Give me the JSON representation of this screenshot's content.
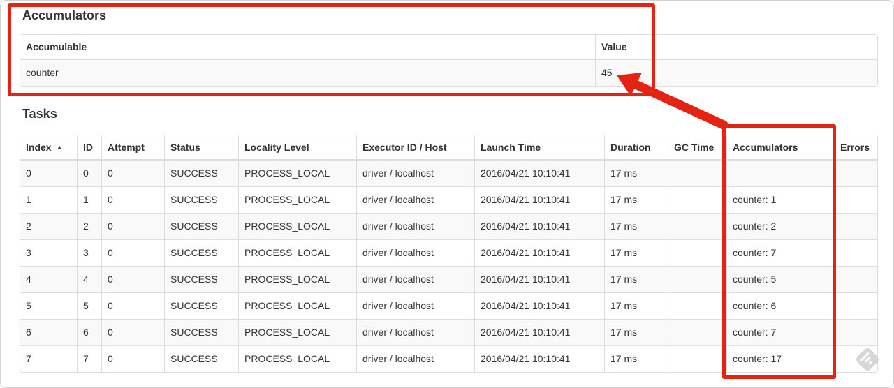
{
  "accumulators_section": {
    "title": "Accumulators",
    "table": {
      "headers": [
        "Accumulable",
        "Value"
      ],
      "rows": [
        {
          "accumulable": "counter",
          "value": "45"
        }
      ]
    }
  },
  "tasks_section": {
    "title": "Tasks",
    "table": {
      "headers": [
        "Index",
        "ID",
        "Attempt",
        "Status",
        "Locality Level",
        "Executor ID / Host",
        "Launch Time",
        "Duration",
        "GC Time",
        "Accumulators",
        "Errors"
      ],
      "sort": {
        "column": "Index",
        "direction": "ascending",
        "icon": "▲"
      },
      "rows": [
        {
          "index": "0",
          "id": "0",
          "attempt": "0",
          "status": "SUCCESS",
          "locality_level": "PROCESS_LOCAL",
          "executor_id_host": "driver / localhost",
          "launch_time": "2016/04/21 10:10:41",
          "duration": "17 ms",
          "gc_time": "",
          "accumulators": "",
          "errors": ""
        },
        {
          "index": "1",
          "id": "1",
          "attempt": "0",
          "status": "SUCCESS",
          "locality_level": "PROCESS_LOCAL",
          "executor_id_host": "driver / localhost",
          "launch_time": "2016/04/21 10:10:41",
          "duration": "17 ms",
          "gc_time": "",
          "accumulators": "counter: 1",
          "errors": ""
        },
        {
          "index": "2",
          "id": "2",
          "attempt": "0",
          "status": "SUCCESS",
          "locality_level": "PROCESS_LOCAL",
          "executor_id_host": "driver / localhost",
          "launch_time": "2016/04/21 10:10:41",
          "duration": "17 ms",
          "gc_time": "",
          "accumulators": "counter: 2",
          "errors": ""
        },
        {
          "index": "3",
          "id": "3",
          "attempt": "0",
          "status": "SUCCESS",
          "locality_level": "PROCESS_LOCAL",
          "executor_id_host": "driver / localhost",
          "launch_time": "2016/04/21 10:10:41",
          "duration": "17 ms",
          "gc_time": "",
          "accumulators": "counter: 7",
          "errors": ""
        },
        {
          "index": "4",
          "id": "4",
          "attempt": "0",
          "status": "SUCCESS",
          "locality_level": "PROCESS_LOCAL",
          "executor_id_host": "driver / localhost",
          "launch_time": "2016/04/21 10:10:41",
          "duration": "17 ms",
          "gc_time": "",
          "accumulators": "counter: 5",
          "errors": ""
        },
        {
          "index": "5",
          "id": "5",
          "attempt": "0",
          "status": "SUCCESS",
          "locality_level": "PROCESS_LOCAL",
          "executor_id_host": "driver / localhost",
          "launch_time": "2016/04/21 10:10:41",
          "duration": "17 ms",
          "gc_time": "",
          "accumulators": "counter: 6",
          "errors": ""
        },
        {
          "index": "6",
          "id": "6",
          "attempt": "0",
          "status": "SUCCESS",
          "locality_level": "PROCESS_LOCAL",
          "executor_id_host": "driver / localhost",
          "launch_time": "2016/04/21 10:10:41",
          "duration": "17 ms",
          "gc_time": "",
          "accumulators": "counter: 7",
          "errors": ""
        },
        {
          "index": "7",
          "id": "7",
          "attempt": "0",
          "status": "SUCCESS",
          "locality_level": "PROCESS_LOCAL",
          "executor_id_host": "driver / localhost",
          "launch_time": "2016/04/21 10:10:41",
          "duration": "17 ms",
          "gc_time": "",
          "accumulators": "counter: 17",
          "errors": ""
        }
      ]
    }
  },
  "annotations": {
    "highlight_color": "#e42313"
  }
}
